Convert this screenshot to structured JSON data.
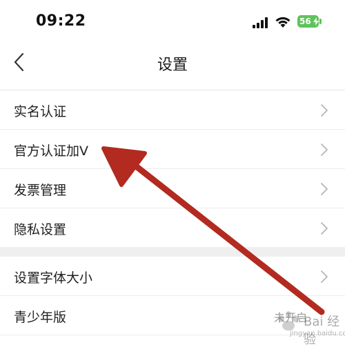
{
  "status_bar": {
    "time": "09:22",
    "battery": "56"
  },
  "nav": {
    "title": "设置"
  },
  "settings": {
    "group1": [
      {
        "label": "实名认证"
      },
      {
        "label": "官方认证加V"
      },
      {
        "label": "发票管理"
      },
      {
        "label": "隐私设置"
      }
    ],
    "group2": [
      {
        "label": "设置字体大小"
      },
      {
        "label": "青少年版",
        "value": "未开启"
      }
    ]
  },
  "watermark": {
    "text": "Bai 经验",
    "sub": "jingyan.baidu.com"
  },
  "colors": {
    "accent_arrow": "#b22a20",
    "battery": "#5ec35b"
  }
}
